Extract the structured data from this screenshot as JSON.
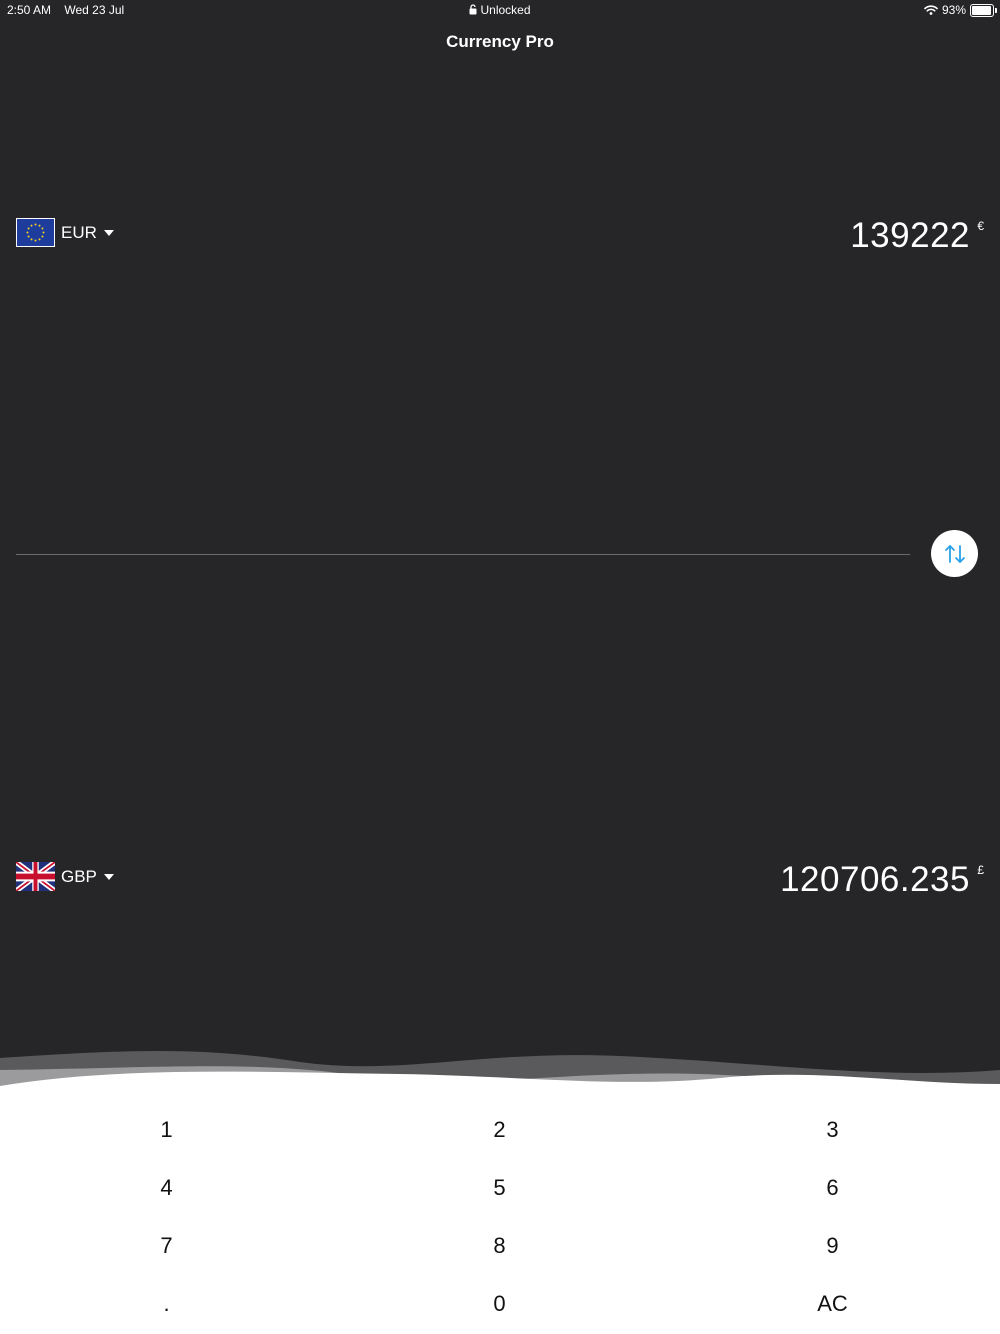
{
  "status_bar": {
    "time": "2:50 AM",
    "date": "Wed 23 Jul",
    "lock_status": "Unlocked",
    "battery": "93%",
    "battery_level": 0.93
  },
  "app": {
    "title": "Currency Pro"
  },
  "from": {
    "code": "EUR",
    "amount": "139222",
    "symbol": "€",
    "flag": "eu-flag-icon"
  },
  "to": {
    "code": "GBP",
    "amount": "120706.235",
    "symbol": "£",
    "flag": "uk-flag-icon"
  },
  "keypad": {
    "keys": [
      "1",
      "2",
      "3",
      "4",
      "5",
      "6",
      "7",
      "8",
      "9",
      ".",
      "0",
      "AC"
    ]
  },
  "colors": {
    "background": "#262629",
    "accent": "#2aa0e8",
    "keypad": "#ffffff"
  }
}
